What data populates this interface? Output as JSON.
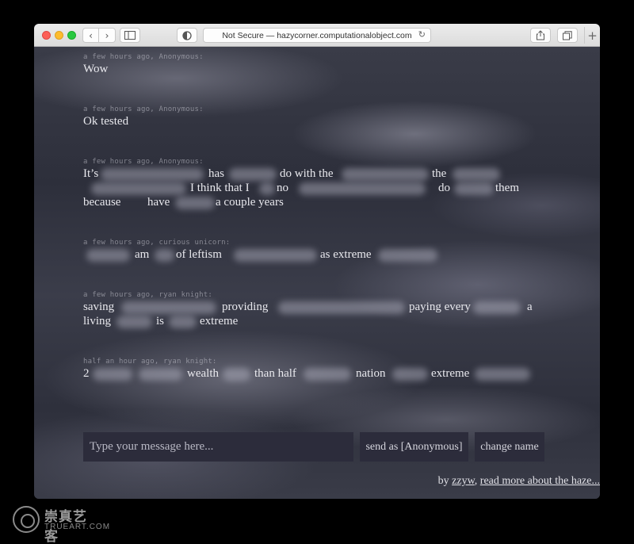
{
  "browser": {
    "back_glyph": "‹",
    "forward_glyph": "›",
    "address": "Not Secure — hazycorner.computationalobject.com",
    "reload_glyph": "↻",
    "add_tab_glyph": "+"
  },
  "messages": [
    {
      "meta": "a few hours ago, Anonymous:",
      "lines": [
        [
          "Wow"
        ]
      ]
    },
    {
      "meta": "a few hours ago, Anonymous:",
      "lines": [
        [
          "Ok tested"
        ]
      ]
    },
    {
      "meta": "a few hours ago, Anonymous:",
      "lines": [
        [
          "It’s",
          "has",
          "do with the",
          "the"
        ],
        [
          "I think that I",
          "no",
          "do",
          "them"
        ],
        [
          "because",
          "have",
          "a couple years"
        ]
      ]
    },
    {
      "meta": "a few hours ago, curious unicorn:",
      "lines": [
        [
          "am",
          "of leftism",
          "as extreme"
        ]
      ]
    },
    {
      "meta": "a few hours ago, ryan knight:",
      "lines": [
        [
          "saving",
          "providing",
          "paying every",
          "a"
        ],
        [
          "living",
          "is",
          "extreme"
        ]
      ]
    },
    {
      "meta": "half an hour ago, ryan knight:",
      "lines": [
        [
          "2",
          "wealth",
          "than half",
          "nation",
          "extreme"
        ]
      ]
    }
  ],
  "composer": {
    "placeholder": "Type your message here...",
    "send_label": "send as [Anonymous]",
    "rename_label": "change name"
  },
  "footer": {
    "by": "by",
    "author": "zzyw",
    "sep": ",",
    "more": "read more about the haze..."
  },
  "watermark": {
    "cn": "崇真艺客",
    "en": "TRUEART.COM"
  }
}
